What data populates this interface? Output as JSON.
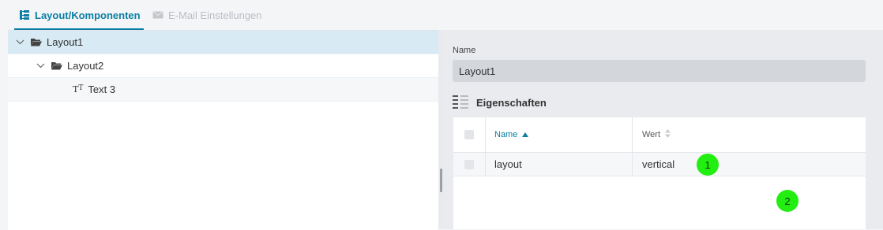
{
  "tabs": [
    {
      "label": "Layout/Komponenten",
      "icon": "tree-structure-icon",
      "active": true
    },
    {
      "label": "E-Mail Einstellungen",
      "icon": "envelope-icon",
      "active": false
    }
  ],
  "tree": [
    {
      "label": "Layout1",
      "level": 1,
      "expanded": true,
      "selected": true,
      "icon": "folder-open-icon"
    },
    {
      "label": "Layout2",
      "level": 2,
      "expanded": true,
      "selected": false,
      "icon": "folder-open-icon"
    },
    {
      "label": "Text 3",
      "level": 3,
      "selected": false,
      "icon": "text-type-icon"
    }
  ],
  "details": {
    "name_label": "Name",
    "name_value": "Layout1",
    "properties_title": "Eigenschaften",
    "table": {
      "headers": {
        "name": "Name",
        "value": "Wert"
      },
      "rows": [
        {
          "name": "layout",
          "value": "vertical"
        }
      ]
    }
  },
  "markers": [
    "1",
    "2"
  ],
  "colors": {
    "accent": "#0a7ea4",
    "selection": "#d8eaf3",
    "marker": "#22ee11"
  }
}
